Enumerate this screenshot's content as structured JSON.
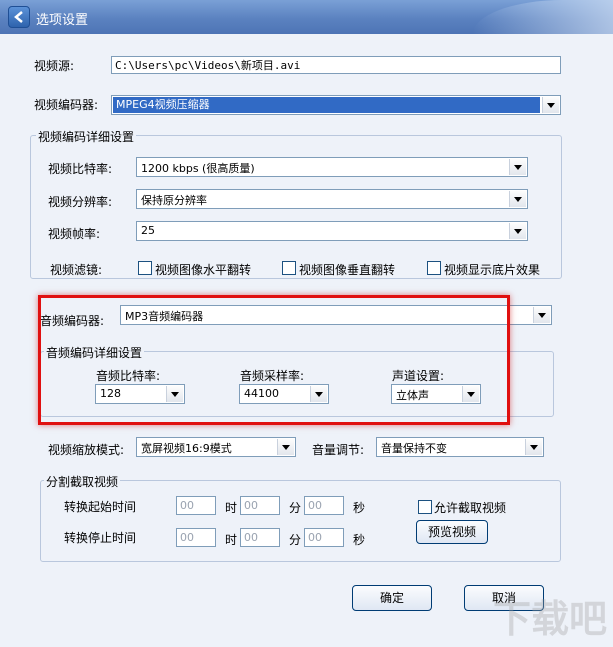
{
  "window": {
    "title": "选项设置"
  },
  "video": {
    "source_label": "视频源:",
    "source_value": "C:\\Users\\pc\\Videos\\新项目.avi",
    "encoder_label": "视频编码器:",
    "encoder_value": "MPEG4视频压缩器",
    "detail_group": "视频编码详细设置",
    "bitrate_label": "视频比特率:",
    "bitrate_value": "1200 kbps (很高质量)",
    "resolution_label": "视频分辨率:",
    "resolution_value": "保持原分辨率",
    "framerate_label": "视频帧率:",
    "framerate_value": "25",
    "filter_label": "视频滤镜:",
    "filters": [
      "视频图像水平翻转",
      "视频图像垂直翻转",
      "视频显示底片效果"
    ]
  },
  "audio": {
    "encoder_label": "音频编码器:",
    "encoder_value": "MP3音频编码器",
    "detail_group": "音频编码详细设置",
    "bitrate_label": "音频比特率:",
    "bitrate_value": "128",
    "samplerate_label": "音频采样率:",
    "samplerate_value": "44100",
    "channel_label": "声道设置:",
    "channel_value": "立体声"
  },
  "scale": {
    "mode_label": "视频缩放模式:",
    "mode_value": "宽屏视频16:9模式",
    "volume_label": "音量调节:",
    "volume_value": "音量保持不变"
  },
  "split": {
    "group": "分割截取视频",
    "start_label": "转换起始时间",
    "end_label": "转换停止时间",
    "placeholder": "00",
    "hour": "时",
    "minute": "分",
    "second": "秒",
    "allow_label": "允许截取视频",
    "preview_label": "预览视频"
  },
  "buttons": {
    "ok": "确定",
    "cancel": "取消"
  },
  "watermark": "下载吧",
  "colors": {
    "titlebar": "#5b82c0",
    "selection": "#316ac5",
    "highlight_box": "#e01010"
  }
}
